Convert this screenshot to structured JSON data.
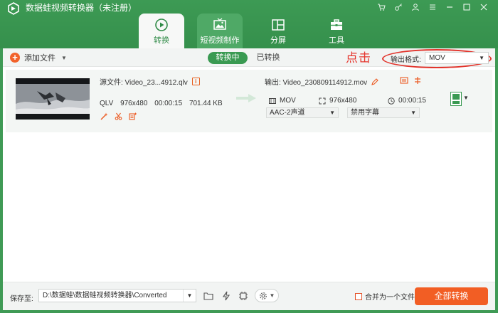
{
  "app": {
    "title": "数据蛙视频转换器（未注册）"
  },
  "nav_tabs": [
    {
      "label": "转换",
      "icon": "convert-icon",
      "active": true
    },
    {
      "label": "短视频制作",
      "icon": "video-maker-icon",
      "active": false
    },
    {
      "label": "分屏",
      "icon": "split-screen-icon",
      "active": false
    },
    {
      "label": "工具",
      "icon": "toolbox-icon",
      "active": false
    }
  ],
  "toolbar": {
    "add_file_label": "添加文件",
    "segment_converting": "转换中",
    "segment_converted": "已转换",
    "hint_text": "点击",
    "output_format_label": "输出格式:",
    "output_format_value": "MOV"
  },
  "file": {
    "source_label": "源文件: Video_23...4912.qlv",
    "format": "QLV",
    "resolution": "976x480",
    "duration": "00:00:15",
    "size": "701.44 KB",
    "output_label": "输出: Video_230809114912.mov",
    "out_format": "MOV",
    "out_resolution": "976x480",
    "out_duration": "00:00:15",
    "audio_track": "AAC-2声道",
    "subtitle": "禁用字幕"
  },
  "footer": {
    "save_to_label": "保存至:",
    "path": "D:\\数据蛙\\数据蛙视频转换器\\Converted",
    "merge_label": "合并为一个文件",
    "convert_all_label": "全部转换"
  },
  "colors": {
    "brand_green": "#3a9a52",
    "accent_orange": "#f25e24",
    "annotation_red": "#e2342c"
  }
}
